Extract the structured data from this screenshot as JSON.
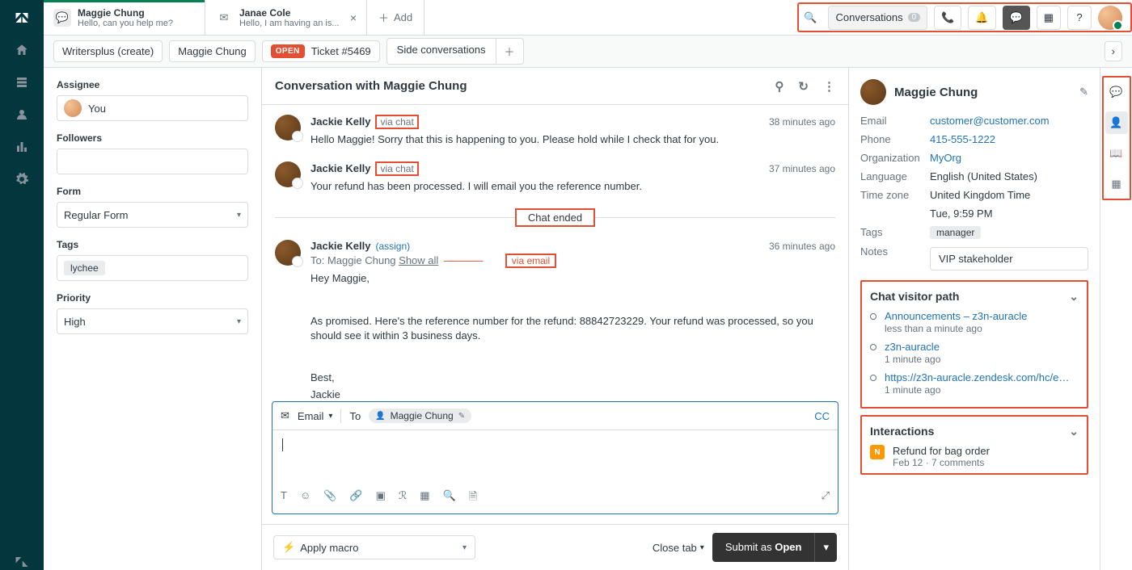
{
  "tabs": [
    {
      "title": "Maggie Chung",
      "subtitle": "Hello, can you help me?",
      "kind": "chat",
      "closable": false,
      "active": true
    },
    {
      "title": "Janae Cole",
      "subtitle": "Hello, I am having an is...",
      "kind": "email",
      "closable": true,
      "active": false
    }
  ],
  "add_label": "Add",
  "top_right": {
    "conversations_label": "Conversations",
    "conversations_count": "0"
  },
  "breadcrumb": {
    "org": "Writersplus (create)",
    "user": "Maggie Chung",
    "open_badge": "OPEN",
    "ticket": "Ticket #5469",
    "side_conversations": "Side conversations"
  },
  "left_form": {
    "assignee_label": "Assignee",
    "assignee_value": "You",
    "followers_label": "Followers",
    "form_label": "Form",
    "form_value": "Regular Form",
    "tags_label": "Tags",
    "tags_value": "lychee",
    "priority_label": "Priority",
    "priority_value": "High"
  },
  "conversation": {
    "header": "Conversation with Maggie Chung",
    "messages": [
      {
        "author": "Jackie Kelly",
        "via": "via chat",
        "time": "38 minutes ago",
        "text": "Hello Maggie! Sorry that this is happening to you. Please hold while I check that for you."
      },
      {
        "author": "Jackie Kelly",
        "via": "via chat",
        "time": "37 minutes ago",
        "text": "Your refund has been processed. I will email you the reference number."
      }
    ],
    "chat_ended": "Chat ended",
    "email_message": {
      "author": "Jackie Kelly",
      "assign": "(assign)",
      "time": "36 minutes ago",
      "to_prefix": "To:",
      "to_name": "Maggie Chung",
      "show_all": "Show all",
      "via_email": "via email",
      "body_lines": [
        "Hey Maggie,",
        "",
        "As promised. Here's the reference number for the refund: 88842723229. Your refund was processed, so you should see it within 3 business days.",
        "",
        "Best,",
        "Jackie"
      ]
    }
  },
  "compose": {
    "channel": "Email",
    "to_label": "To",
    "to_chip": "Maggie Chung",
    "cc": "CC"
  },
  "macro_label": "Apply macro",
  "footer": {
    "close_tab": "Close tab",
    "submit_prefix": "Submit as ",
    "submit_state": "Open"
  },
  "profile": {
    "name": "Maggie Chung",
    "rows": {
      "email_k": "Email",
      "email_v": "customer@customer.com",
      "phone_k": "Phone",
      "phone_v": "415-555-1222",
      "org_k": "Organization",
      "org_v": "MyOrg",
      "lang_k": "Language",
      "lang_v": "English (United States)",
      "tz_k": "Time zone",
      "tz_v": "United Kingdom Time",
      "tz_sub": "Tue, 9:59 PM",
      "tags_k": "Tags",
      "tags_v": "manager",
      "notes_k": "Notes",
      "notes_v": "VIP stakeholder"
    }
  },
  "chat_visitor_path": {
    "title": "Chat visitor path",
    "items": [
      {
        "link": "Announcements – z3n-auracle",
        "sub": "less than a minute ago"
      },
      {
        "link": "z3n-auracle",
        "sub": "1 minute ago"
      },
      {
        "link": "https://z3n-auracle.zendesk.com/hc/en...",
        "sub": "1 minute ago"
      }
    ]
  },
  "interactions": {
    "title": "Interactions",
    "item_title": "Refund for bag order",
    "item_sub": "Feb 12 · 7 comments"
  }
}
